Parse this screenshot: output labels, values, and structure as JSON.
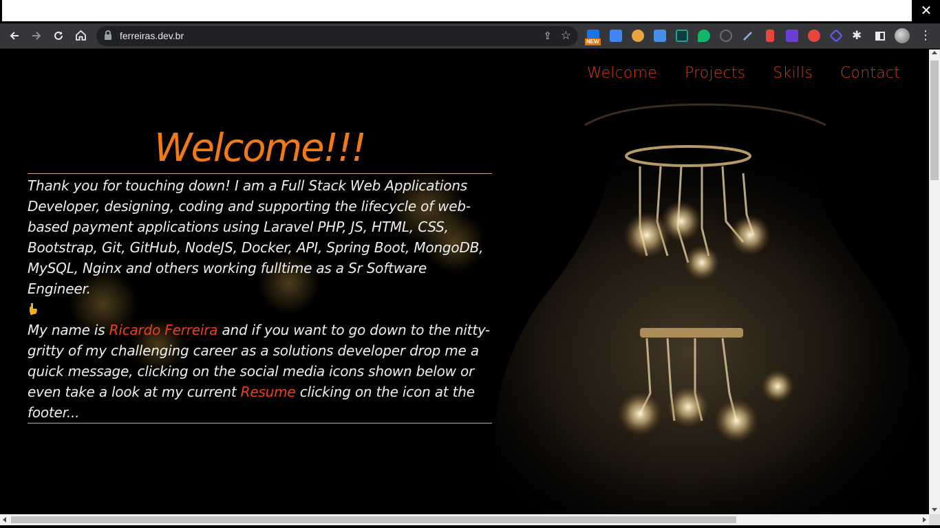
{
  "browser": {
    "close_glyph": "✕",
    "nav": {
      "back_icon": "arrow-left-icon",
      "forward_icon": "arrow-right-icon",
      "reload_icon": "reload-icon",
      "home_icon": "home-icon"
    },
    "url": "ferreiras.dev.br",
    "new_badge": "NEW",
    "extension_colors": [
      "#1a73e8",
      "#4285f4",
      "#e8a33d",
      "#4a8fe7",
      "#1fa78a",
      "#12b76a",
      "#6b6b6b",
      "#8ab4f8",
      "#e8453c",
      "#6a3fd3",
      "#e8453c",
      "#5a5ae0"
    ]
  },
  "site": {
    "nav": [
      "Welcome",
      "Projects",
      "Skills",
      "Contact"
    ],
    "heading": "Welcome!!!",
    "intro": "Thank you for touching down! I am a Full Stack Web Applications Developer, designing, coding and supporting the lifecycle of web-based payment applications using Laravel PHP, JS, HTML, CSS, Bootstrap, Git, GitHub, NodeJS, Docker, API, Spring Boot, MongoDB, MySQL, Nginx and others working fulltime as a Sr Software Engineer.",
    "name_prefix": "My name is ",
    "name": "Ricardo Ferreira",
    "name_suffix": " and if you want to go down to the nitty-gritty of my challenging career as a solutions developer drop me a quick message, clicking on the social media icons shown below or even take a look at my current ",
    "resume": "Resume",
    "resume_suffix": " clicking on the icon at the footer...",
    "colors": {
      "nav": "#d33a0f",
      "heading": "#f07a18",
      "highlight": "#ef3f14",
      "text": "#eeeeee",
      "background": "#000000"
    }
  }
}
